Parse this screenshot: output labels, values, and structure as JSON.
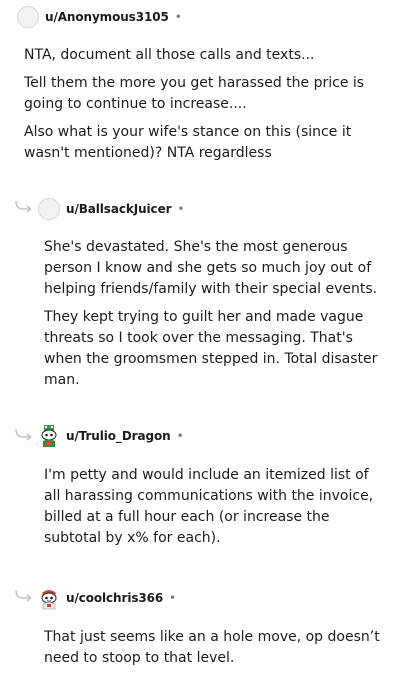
{
  "comments": [
    {
      "username": "u/Anonymous3105",
      "separator": "•",
      "avatar_icon": "default-avatar-icon",
      "paragraphs": [
        "NTA, document all those calls and texts...",
        "Tell them the more you get harassed the price is going to continue to increase....",
        "Also what is your wife's stance on this (since it wasn't mentioned)? NTA regardless"
      ]
    },
    {
      "username": "u/BallsackJuicer",
      "separator": "•",
      "avatar_icon": "default-avatar-icon",
      "paragraphs": [
        "She's devastated. She's the most generous person I know and she gets so much joy out of helping friends/family with their special events.",
        "They kept trying to guilt her and made vague threats so I took over the messaging. That's when the groomsmen stepped in. Total disaster man."
      ]
    },
    {
      "username": "u/Trulio_Dragon",
      "separator": "•",
      "avatar_icon": "snoo-green-avatar-icon",
      "paragraphs": [
        "I'm petty and would include an itemized list of all harassing communications with the invoice, billed at a full hour each (or increase the subtotal by x% for each)."
      ]
    },
    {
      "username": "u/coolchris366",
      "separator": "•",
      "avatar_icon": "snoo-red-avatar-icon",
      "paragraphs": [
        "That just seems like an a hole move, op doesn’t need to stoop to that level."
      ]
    }
  ]
}
